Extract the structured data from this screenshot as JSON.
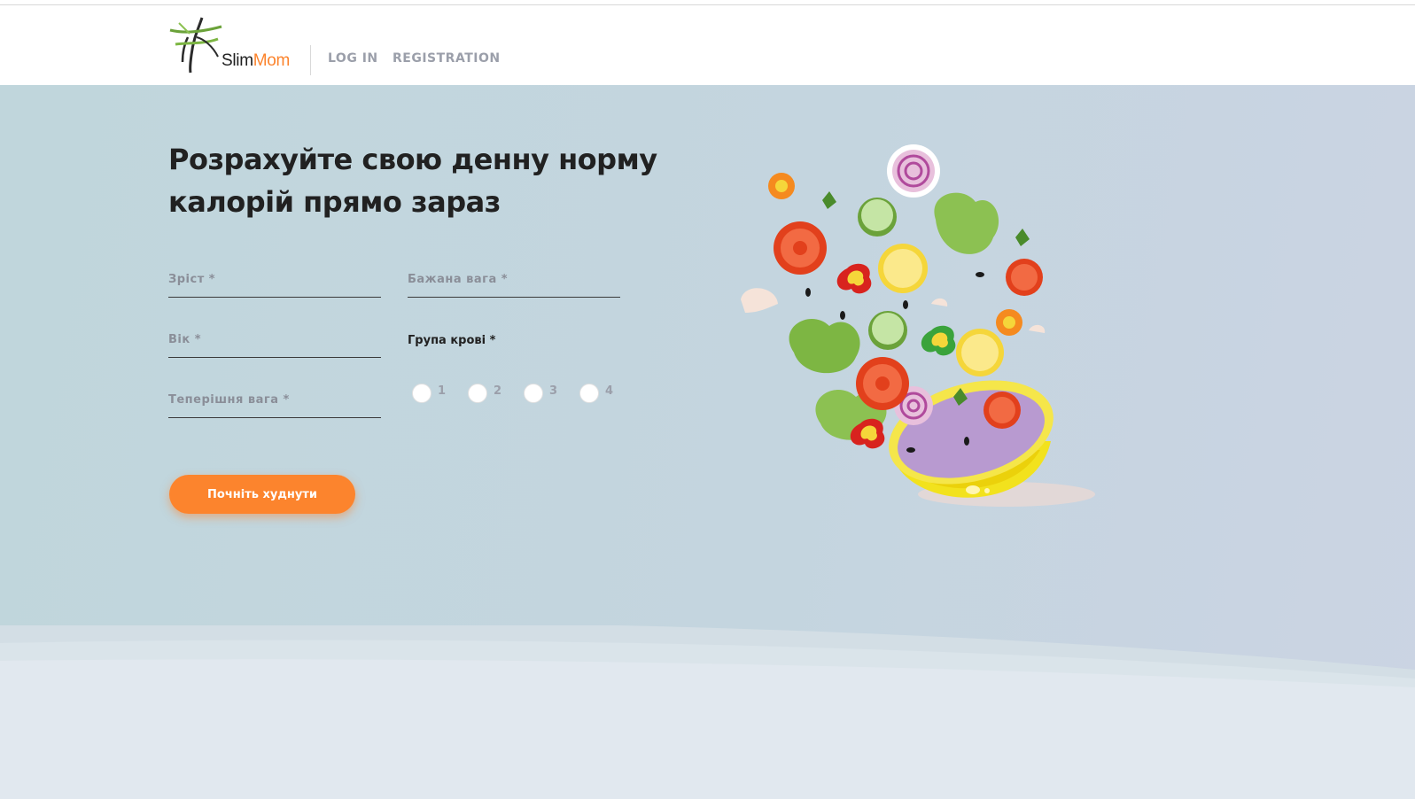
{
  "header": {
    "logo": {
      "slim": "Slim",
      "mom": "Mom"
    },
    "nav": {
      "login": "LOG IN",
      "registration": "REGISTRATION"
    }
  },
  "main": {
    "title": "Розрахуйте свою денну норму калорій прямо зараз",
    "form": {
      "height_placeholder": "Зріст *",
      "age_placeholder": "Вік *",
      "current_weight_placeholder": "Теперішня вага *",
      "desired_weight_placeholder": "Бажана вага *",
      "blood_group_label": "Група крові *",
      "blood_groups": [
        "1",
        "2",
        "3",
        "4"
      ],
      "submit_label": "Почніть худнути"
    }
  },
  "colors": {
    "accent": "#fc842d",
    "text_dark": "#212121",
    "text_muted": "#9b9faa",
    "background": "#c4d5df"
  },
  "icons": {
    "logo": "slimmom-logo-icon",
    "illustration": "salad-bowl-illustration"
  }
}
